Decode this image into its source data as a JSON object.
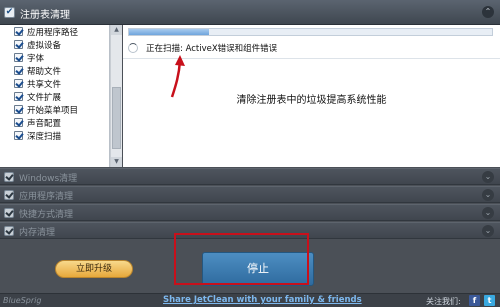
{
  "header": {
    "title": "注册表清理",
    "check_mark": "✔",
    "collapse_arrow": "⌃"
  },
  "list": {
    "items": [
      {
        "label": "应用程序路径",
        "checked": true
      },
      {
        "label": "虚拟设备",
        "checked": true
      },
      {
        "label": "字体",
        "checked": true
      },
      {
        "label": "帮助文件",
        "checked": true
      },
      {
        "label": "共享文件",
        "checked": true
      },
      {
        "label": "文件扩展",
        "checked": true
      },
      {
        "label": "开始菜单项目",
        "checked": true
      },
      {
        "label": "声音配置",
        "checked": true
      },
      {
        "label": "深度扫描",
        "checked": true
      }
    ]
  },
  "scan": {
    "progress_fraction": 0.22,
    "status_text": "正在扫描: ActiveX错误和组件错误",
    "message": "清除注册表中的垃圾提高系统性能"
  },
  "sections": [
    {
      "title": "Windows清理"
    },
    {
      "title": "应用程序清理"
    },
    {
      "title": "快捷方式清理"
    },
    {
      "title": "内存清理"
    }
  ],
  "actions": {
    "upgrade_label": "立即升级",
    "stop_label": "停止"
  },
  "footer": {
    "brand": "BlueSprig",
    "share_text": "Share JetClean with your family & friends",
    "follow_text": "关注我们:",
    "facebook_glyph": "f",
    "twitter_glyph": "t"
  },
  "colors": {
    "accent_blue": "#2f6b9f",
    "annotation_red": "#c8101b",
    "upgrade_gold": "#e7a83b"
  }
}
